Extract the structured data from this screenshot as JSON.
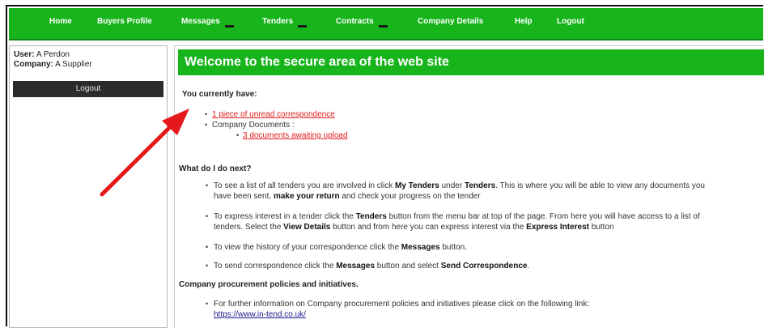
{
  "nav": {
    "items": [
      {
        "label": "Home"
      },
      {
        "label": "Buyers Profile"
      },
      {
        "label": "Messages"
      },
      {
        "label": "Tenders"
      },
      {
        "label": "Contracts"
      },
      {
        "label": "Company Details"
      },
      {
        "label": "Help"
      },
      {
        "label": "Logout"
      }
    ]
  },
  "sidebar": {
    "user_label": "User:",
    "user_value": "A Perdon",
    "company_label": "Company:",
    "company_value": "A Supplier",
    "logout_label": "Logout"
  },
  "main": {
    "banner_title": "Welcome to the secure area of the web site",
    "have_heading": "You currently have:",
    "unread_link": "1 piece of unread correspondence",
    "company_docs": "Company Documents :",
    "docs_link": "3 documents awaiting upload",
    "next_heading": "What do I do next?",
    "p1_a": "To see a list of all tenders you are involved in click ",
    "p1_b": "My Tenders",
    "p1_c": " under ",
    "p1_d": "Tenders",
    "p1_e": ". This is where you will be able to view any documents you",
    "p1_f": "have been sent, ",
    "p1_g": "make your return",
    "p1_h": " and check your progress on the tender",
    "p2_a": "To express interest in a tender click the ",
    "p2_b": "Tenders",
    "p2_c": " button from the menu bar at top of the page. From here you will have access to a list of",
    "p2_d": "tenders. Select the ",
    "p2_e": "View Details",
    "p2_f": " button and from here you can express interest via the ",
    "p2_g": "Express Interest",
    "p2_h": " button",
    "p3_a": "To view the history of your correspondence click the ",
    "p3_b": "Messages",
    "p3_c": " button.",
    "p4_a": "To send correspondence click the ",
    "p4_b": "Messages",
    "p4_c": " button and select ",
    "p4_d": "Send Correspondence",
    "p4_e": ".",
    "policy_heading": "Company procurement policies and initiatives.",
    "p5": "For further information on Company procurement policies and initiatives please click on the following link:",
    "policy_link": "https://www.in-tend.co.uk/"
  },
  "colors": {
    "nav_green": "#18b41c",
    "link_red": "#e01a1a",
    "arrow_red": "#e5191b"
  },
  "icons": {
    "bullet": "•"
  }
}
